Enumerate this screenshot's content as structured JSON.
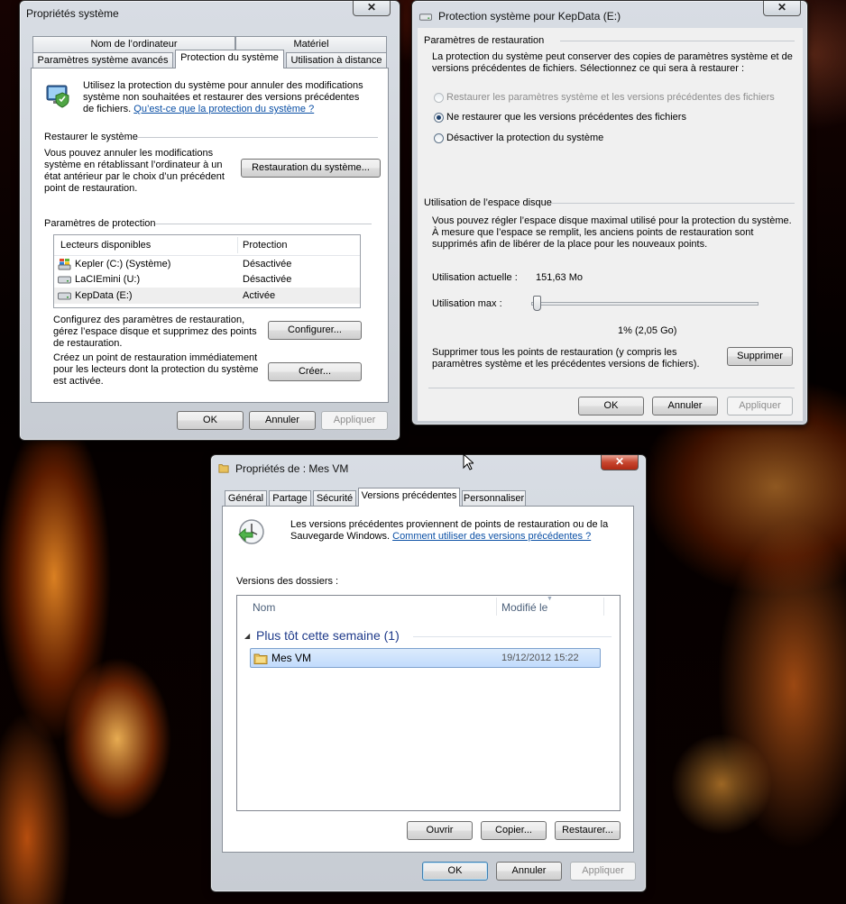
{
  "sys_props": {
    "title": "Propriétés système",
    "tabs_top": [
      "Nom de l’ordinateur",
      "Matériel"
    ],
    "tabs_bottom": [
      "Paramètres système avancés",
      "Protection du système",
      "Utilisation à distance"
    ],
    "intro": "Utilisez la protection du système pour annuler des modifications système non souhaitées et restaurer des versions précédentes de fichiers.",
    "intro_link": "Qu’est-ce que la protection du système ?",
    "restore_heading": "Restaurer le système",
    "restore_text": "Vous pouvez annuler les modifications système en rétablissant l’ordinateur à un état antérieur par le choix d’un précédent point de restauration.",
    "restore_button": "Restauration du système...",
    "protection_heading": "Paramètres de protection",
    "col_drives": "Lecteurs disponibles",
    "col_protection": "Protection",
    "drives": [
      {
        "name": "Kepler (C:) (Système)",
        "status": "Désactivée",
        "icon": "windows-drive-icon"
      },
      {
        "name": "LaCIEmini (U:)",
        "status": "Désactivée",
        "icon": "drive-icon"
      },
      {
        "name": "KepData (E:)",
        "status": "Activée",
        "icon": "drive-icon"
      }
    ],
    "configure_text": "Configurez des paramètres de restauration, gérez l’espace disque et supprimez des points de restauration.",
    "configure_button": "Configurer...",
    "create_text": "Créez un point de restauration immédiatement pour les lecteurs dont la protection du système est activée.",
    "create_button": "Créer...",
    "ok": "OK",
    "cancel": "Annuler",
    "apply": "Appliquer"
  },
  "protect": {
    "title": "Protection système pour KepData (E:)",
    "restore_heading": "Paramètres de restauration",
    "restore_text": "La protection du système peut conserver des copies de paramètres système et de versions précédentes de fichiers. Sélectionnez ce qui sera à restaurer :",
    "options": [
      "Restaurer les paramètres système et les versions précédentes des fichiers",
      "Ne restaurer que les versions précédentes des fichiers",
      "Désactiver la protection du système"
    ],
    "disk_heading": "Utilisation de l’espace disque",
    "disk_text": "Vous pouvez régler l’espace disque maximal utilisé pour la protection du système. À mesure que l’espace se remplit, les anciens points de restauration sont supprimés afin de libérer de la place pour les nouveaux points.",
    "current_label": "Utilisation actuelle :",
    "current_value": "151,63 Mo",
    "max_label": "Utilisation max :",
    "slider_fraction": 0.01,
    "max_value": "1% (2,05 Go)",
    "delete_text": "Supprimer tous les points de restauration (y compris les paramètres système et les précédentes versions de fichiers).",
    "delete_button": "Supprimer",
    "ok": "OK",
    "cancel": "Annuler",
    "apply": "Appliquer"
  },
  "vm": {
    "title": "Propriétés de : Mes VM",
    "tabs": [
      "Général",
      "Partage",
      "Sécurité",
      "Versions précédentes",
      "Personnaliser"
    ],
    "intro": "Les versions précédentes proviennent de points de restauration ou de la Sauvegarde Windows.",
    "intro_link": "Comment utiliser des versions précédentes ?",
    "versions_label": "Versions des dossiers :",
    "col_name": "Nom",
    "col_modified": "Modifié le",
    "group": "Plus tôt cette semaine (1)",
    "row_name": "Mes VM",
    "row_date": "19/12/2012 15:22",
    "open": "Ouvrir",
    "copy": "Copier...",
    "restore": "Restaurer...",
    "ok": "OK",
    "cancel": "Annuler",
    "apply": "Appliquer"
  }
}
